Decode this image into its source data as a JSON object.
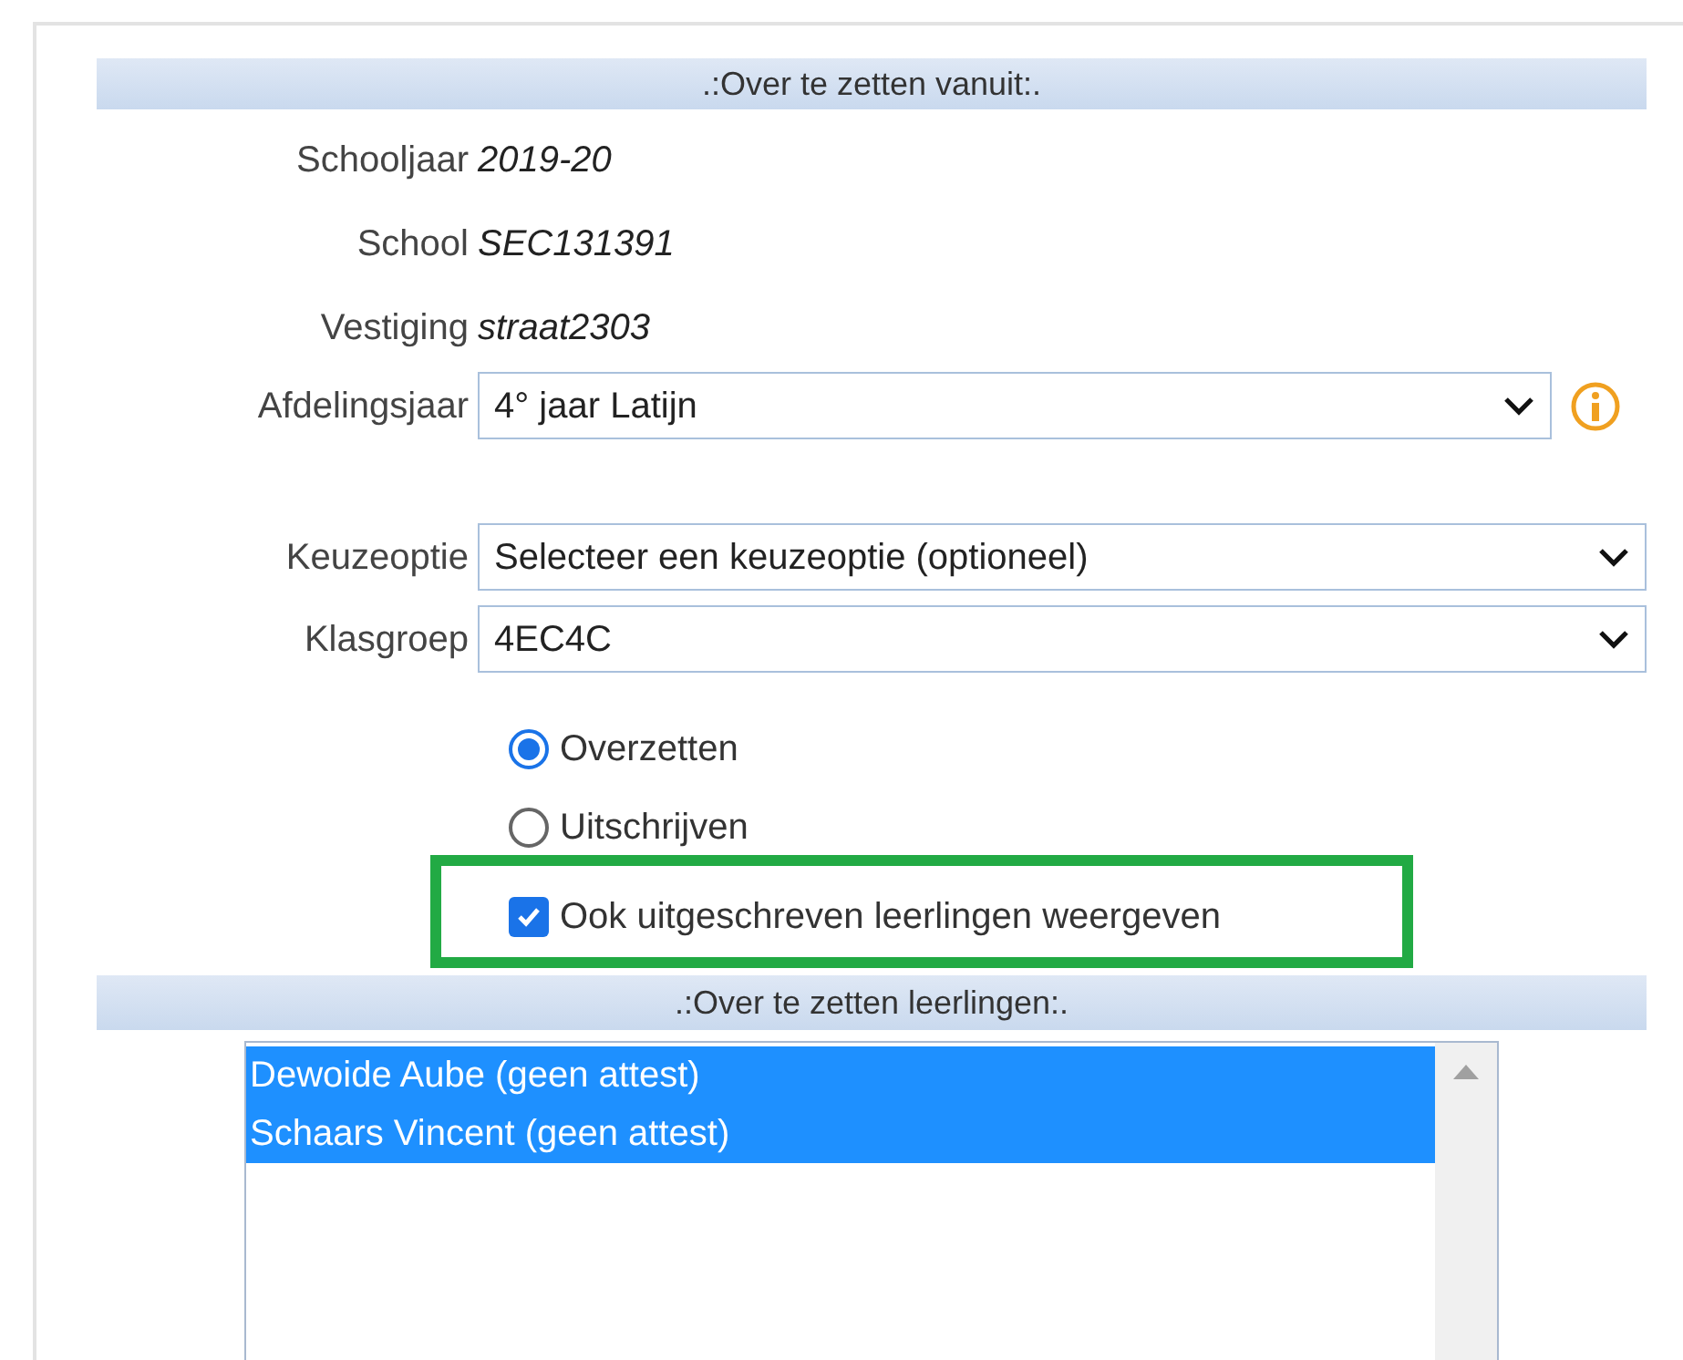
{
  "source_section": {
    "title": ".:Over te zetten vanuit:.",
    "info": [
      {
        "label": "Schooljaar",
        "value": "2019-20"
      },
      {
        "label": "School",
        "value": "SEC131391"
      },
      {
        "label": "Vestiging",
        "value": "straat2303"
      }
    ],
    "afdelingsjaar": {
      "label": "Afdelingsjaar",
      "value": "4° jaar Latijn"
    },
    "selects": [
      {
        "label": "Keuzeoptie",
        "value": "Selecteer een keuzeoptie (optioneel)"
      },
      {
        "label": "Klasgroep",
        "value": "4EC4C"
      }
    ],
    "radios": [
      {
        "label": "Overzetten",
        "selected": true
      },
      {
        "label": "Uitschrijven",
        "selected": false
      }
    ],
    "checkbox": {
      "label": "Ook uitgeschreven leerlingen weergeven",
      "checked": true,
      "highlighted": true
    }
  },
  "students_section": {
    "title": ".:Over te zetten leerlingen:.",
    "students": [
      {
        "name": "Dewoide Aube (geen attest)",
        "selected": true
      },
      {
        "name": "Schaars Vincent (geen attest)",
        "selected": true
      }
    ]
  }
}
